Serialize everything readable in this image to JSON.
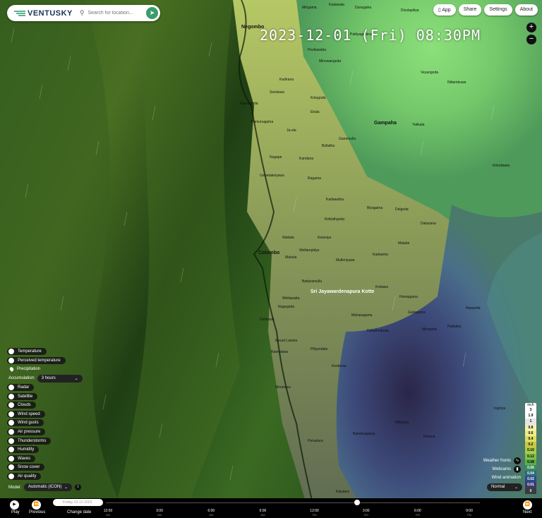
{
  "app": {
    "logo_text": "VENTUSKY",
    "search_placeholder": "Search for location..."
  },
  "top_buttons": [
    {
      "label": "App"
    },
    {
      "label": "Share"
    },
    {
      "label": "Settings"
    },
    {
      "label": "About"
    }
  ],
  "datetime": "2023-12-01 (Fri) 08:30PM",
  "zoom": {
    "in": "+",
    "out": "−"
  },
  "layers": [
    {
      "label": "Temperature"
    },
    {
      "label": "Perceived temperature"
    },
    {
      "label": "Precipitation",
      "active": true
    },
    {
      "label": "Radar"
    },
    {
      "label": "Satellite"
    },
    {
      "label": "Clouds"
    },
    {
      "label": "Wind speed"
    },
    {
      "label": "Wind gusts"
    },
    {
      "label": "Air pressure"
    },
    {
      "label": "Thunderstorms"
    },
    {
      "label": "Humidity"
    },
    {
      "label": "Waves"
    },
    {
      "label": "Snow cover"
    },
    {
      "label": "Air quality"
    }
  ],
  "accumulation": {
    "label": "Accumulation:",
    "value": "3 hours"
  },
  "model": {
    "label": "Model:",
    "value": "Automatic (ICON)"
  },
  "legend": {
    "unit": "inch",
    "values": [
      "3",
      "1.9",
      "1",
      "0.8",
      "0.6",
      "0.4",
      "0.2",
      "0.16",
      "0.12",
      "0.08",
      "0.06",
      "0.04",
      "0.02",
      "0.01",
      "0"
    ],
    "colors": [
      "#ffffff",
      "#ffffff",
      "#e6e6e6",
      "#f4f2b0",
      "#ecec88",
      "#dcdc60",
      "#c8c848",
      "#a8cc48",
      "#84c048",
      "#5cb048",
      "#3a8a5a",
      "#2a6a7a",
      "#2a4a8a",
      "#3a3a6a",
      "#3a3a3a"
    ]
  },
  "side_controls": {
    "weather_fronts": "Weather fronts",
    "webcams": "Webcams",
    "wind_animation": "Wind animation",
    "wind_mode": "Normal"
  },
  "timeline": {
    "play": "Play",
    "previous": "Previous",
    "next": "Next",
    "change_date": "Change date",
    "date_value": "Friday, 01.12.2023",
    "ticks": [
      {
        "t": "12:00",
        "s": "AM"
      },
      {
        "t": "3:00",
        "s": "AM"
      },
      {
        "t": "6:00",
        "s": "AM"
      },
      {
        "t": "9:00",
        "s": "AM"
      },
      {
        "t": "12:00",
        "s": "PM"
      },
      {
        "t": "3:00",
        "s": "PM"
      },
      {
        "t": "6:00",
        "s": "PM"
      },
      {
        "t": "9:00",
        "s": "PM"
      }
    ],
    "current_fraction": 0.69
  },
  "places": [
    {
      "name": "Negombo",
      "bold": true
    },
    {
      "name": "Colombo",
      "bold": true
    },
    {
      "name": "Gampaha",
      "bold": true
    },
    {
      "name": "Sri Jayawardenapura Kotte",
      "bold": true
    },
    {
      "name": "Mirigama"
    },
    {
      "name": "Kadawala"
    },
    {
      "name": "Dunagaha"
    },
    {
      "name": "Divulapitiya"
    },
    {
      "name": "Peellawatta"
    },
    {
      "name": "Minuwangoda"
    },
    {
      "name": "Kotugoda"
    },
    {
      "name": "Ja-ela"
    },
    {
      "name": "Kandana"
    },
    {
      "name": "Ragama"
    },
    {
      "name": "Kadawatha"
    },
    {
      "name": "Kiribathgoda"
    },
    {
      "name": "Kelaniya"
    },
    {
      "name": "Wellampitiya"
    },
    {
      "name": "Kaduwela"
    },
    {
      "name": "Homagama"
    },
    {
      "name": "Maharagama"
    },
    {
      "name": "Battaramulla"
    },
    {
      "name": "Nugegoda"
    },
    {
      "name": "Dehiwala"
    },
    {
      "name": "Mount Lavinia"
    },
    {
      "name": "Moratuwa"
    },
    {
      "name": "Panadura"
    },
    {
      "name": "Kesbewa"
    },
    {
      "name": "Piliyandala"
    },
    {
      "name": "Horana"
    },
    {
      "name": "Padukka"
    },
    {
      "name": "Yakkala"
    },
    {
      "name": "Nittambuwa"
    },
    {
      "name": "Kirindiwela"
    },
    {
      "name": "Veyangoda"
    },
    {
      "name": "Delgoda"
    },
    {
      "name": "Dakarana"
    },
    {
      "name": "Malabe"
    },
    {
      "name": "Hanwella"
    },
    {
      "name": "Ingiriya"
    },
    {
      "name": "Wattala"
    },
    {
      "name": "Ekala"
    },
    {
      "name": "Mabola"
    },
    {
      "name": "Seeduwa"
    },
    {
      "name": "Kapungoda"
    },
    {
      "name": "Kadirana"
    },
    {
      "name": "Pattiyagedera"
    },
    {
      "name": "Pamunugama"
    },
    {
      "name": "Uswetakeiyawa"
    },
    {
      "name": "Nugape"
    },
    {
      "name": "Bollatha"
    },
    {
      "name": "Ganemulla"
    },
    {
      "name": "Biyagama"
    },
    {
      "name": "Mulleriyawa"
    },
    {
      "name": "Kottawa"
    },
    {
      "name": "Kahathuduwa"
    },
    {
      "name": "Bandaragama"
    },
    {
      "name": "Millaniya"
    },
    {
      "name": "Meegoda"
    },
    {
      "name": "Godagama"
    },
    {
      "name": "Wellawatta"
    },
    {
      "name": "Ratmalana"
    },
    {
      "name": "Kalutara"
    }
  ]
}
